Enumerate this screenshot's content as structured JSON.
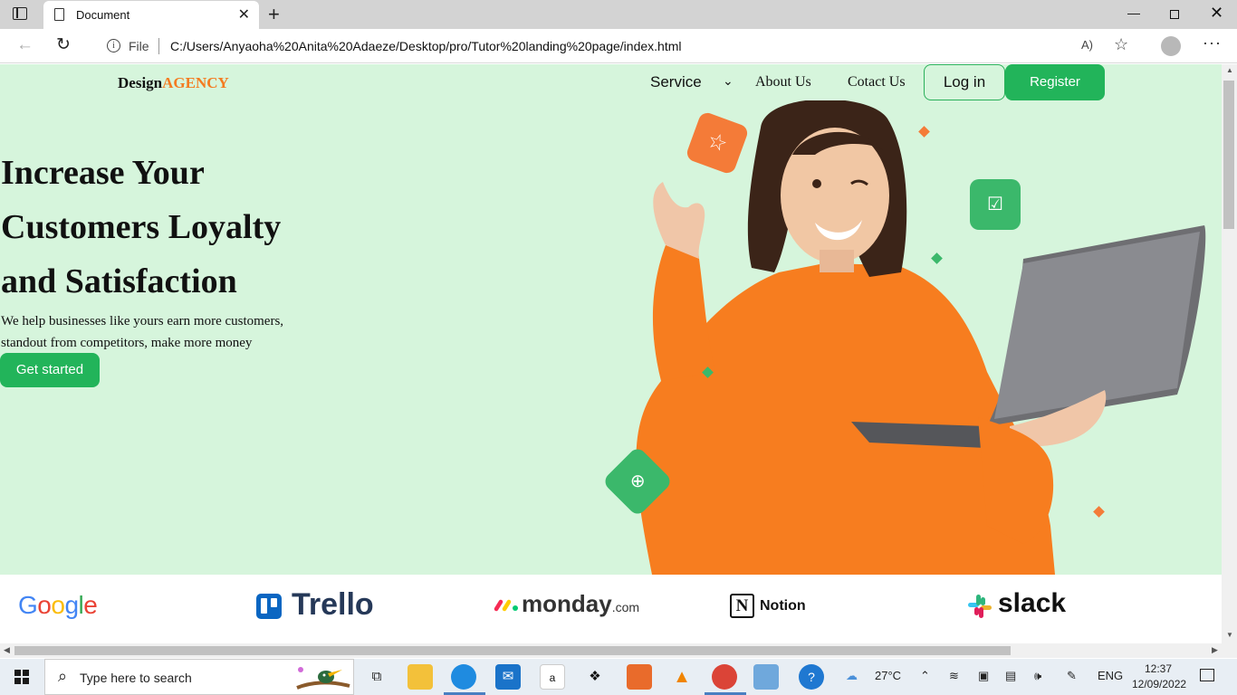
{
  "browser": {
    "tab_title": "Document",
    "tab_close": "✕",
    "new_tab": "+",
    "file_label": "File",
    "url": "C:/Users/Anyaoha%20Anita%20Adaeze/Desktop/pro/Tutor%20landing%20page/index.html",
    "read_aloud": "A)",
    "window_min": "—",
    "window_close": "✕",
    "more": "···"
  },
  "site": {
    "logo_design": "Design",
    "logo_agency": "AGENCY",
    "nav": {
      "service": "Service",
      "about": "About Us",
      "contact": "Cotact Us"
    },
    "login_label": "Log in",
    "register_label": "Register",
    "headline_lines": [
      "Increase Your",
      "Customers Loyalty",
      "and Satisfaction"
    ],
    "subtext": "We help businesses like yours earn more customers, standout from competitors, make more money",
    "cta_label": "Get started",
    "brands": {
      "google": [
        "G",
        "o",
        "o",
        "g",
        "l",
        "e"
      ],
      "trello": "Trello",
      "monday": "monday",
      "monday_suffix": ".com",
      "notion_mark": "N",
      "notion": "Notion",
      "slack": "slack"
    },
    "colors": {
      "accent_orange": "#f47b20",
      "accent_green": "#22b45a",
      "hero_bg": "#d6f5dc"
    }
  },
  "taskbar": {
    "search_placeholder": "Type here to search",
    "weather": "27°C",
    "language": "ENG",
    "time": "12:37",
    "date": "12/09/2022",
    "apps": [
      "task-view",
      "file-explorer",
      "edge",
      "mail",
      "amazon",
      "dropbox",
      "office",
      "vlc",
      "chrome",
      "control-panel",
      "help"
    ]
  }
}
